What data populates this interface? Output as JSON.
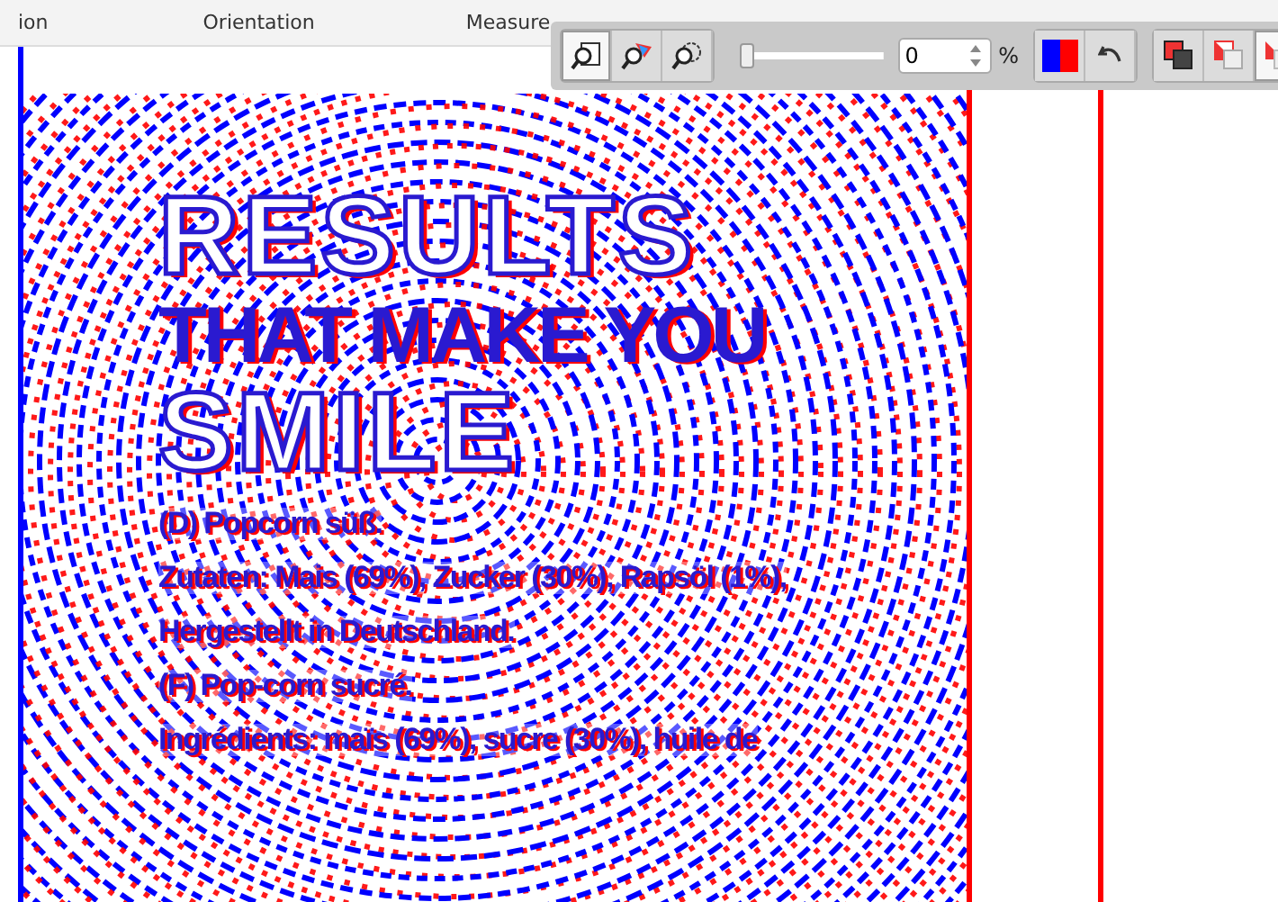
{
  "ribbon": {
    "groups": [
      "ion",
      "Orientation",
      "Measure"
    ]
  },
  "compare_toolbar": {
    "tools": [
      {
        "kind": "overlay",
        "selected": true
      },
      {
        "kind": "color",
        "selected": false
      },
      {
        "kind": "settings",
        "selected": false
      }
    ],
    "opacity_slider": {
      "level": 0
    },
    "opacity_value": "0",
    "unit": "%",
    "modes": [
      {
        "kind": "normal",
        "selected": false
      },
      {
        "kind": "difference",
        "selected": false
      },
      {
        "kind": "highlight",
        "selected": true
      }
    ]
  },
  "document": {
    "headline": [
      {
        "text": "RESULTS",
        "kind": "outline"
      },
      {
        "text": "THAT MAKE YOU",
        "kind": "solid"
      },
      {
        "text": "SMILE",
        "kind": "outline"
      }
    ],
    "lines": [
      "(D) Popcorn süß.",
      "Zutaten: Mais (69%), Zucker (30%), Rapsöl (1%),",
      "Hergestellt in Deutschland.",
      "(F) Pop-corn sucré.",
      "Ingrédients: maïs (69%), sucre (30%), huile de"
    ]
  }
}
